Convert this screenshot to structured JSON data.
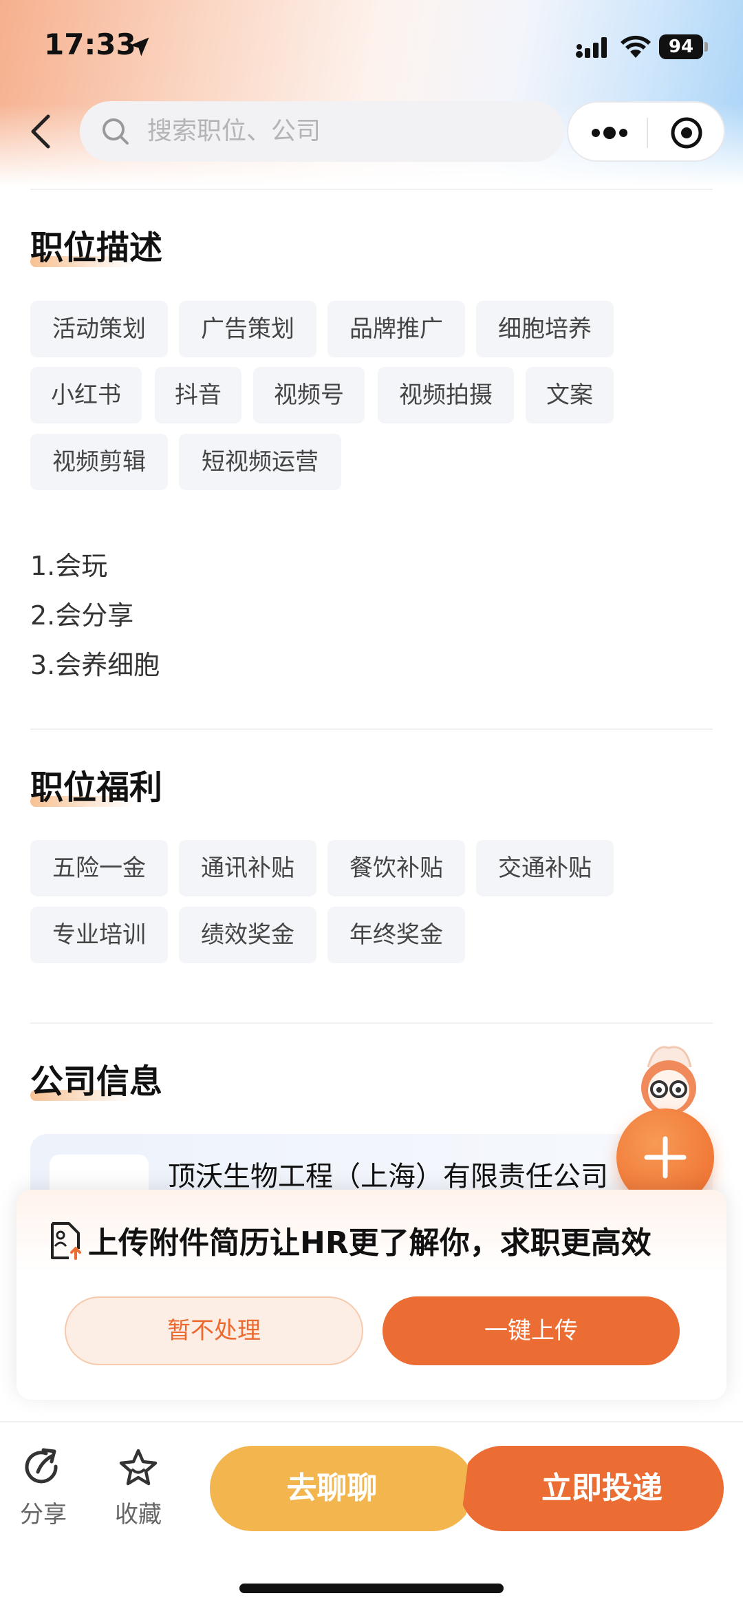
{
  "status_bar": {
    "time": "17:33",
    "battery": "94"
  },
  "search": {
    "placeholder": "搜索职位、公司"
  },
  "job_description": {
    "title": "职位描述",
    "tags": [
      "活动策划",
      "广告策划",
      "品牌推广",
      "细胞培养",
      "小红书",
      "抖音",
      "视频号",
      "视频拍摄",
      "文案",
      "视频剪辑",
      "短视频运营"
    ],
    "lines": [
      "1.会玩",
      "2.会分享",
      "3.会养细胞"
    ]
  },
  "benefits": {
    "title": "职位福利",
    "tags": [
      "五险一金",
      "通讯补贴",
      "餐饮补贴",
      "交通补贴",
      "专业培训",
      "绩效奖金",
      "年终奖金"
    ]
  },
  "company": {
    "title": "公司信息",
    "name": "顶沃生物工程（上海）有限责任公司"
  },
  "upload_prompt": {
    "text": "上传附件简历让HR更了解你，求职更高效",
    "skip_label": "暂不处理",
    "upload_label": "一键上传"
  },
  "bottom_bar": {
    "share_label": "分享",
    "favorite_label": "收藏",
    "chat_label": "去聊聊",
    "apply_label": "立即投递"
  },
  "colors": {
    "accent": "#ec6d33",
    "chat": "#f3b54e",
    "tag_bg": "#f3f5f8"
  }
}
